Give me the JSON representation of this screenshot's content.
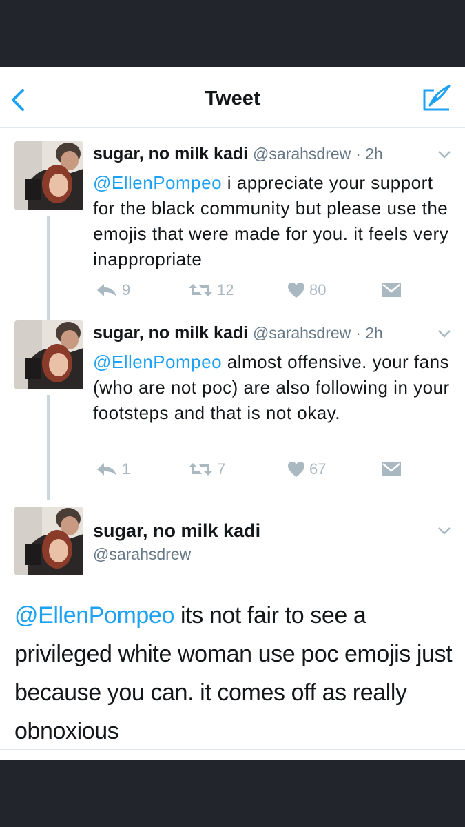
{
  "nav": {
    "title": "Tweet"
  },
  "tweets": [
    {
      "name": "sugar, no milk kadi",
      "handle": "@sarahsdrew",
      "time": "· 2h",
      "mention": "@EllenPompeo",
      "text": " i appreciate your support for the black community but please use the emojis that were made for you. it feels very inappropriate",
      "replies": "9",
      "retweets": "12",
      "likes": "80"
    },
    {
      "name": "sugar, no milk kadi",
      "handle": "@sarahsdrew",
      "time": "· 2h",
      "mention": "@EllenPompeo",
      "text": " almost offensive. your fans (who are not poc) are also following in your footsteps and that is not okay.",
      "replies": "1",
      "retweets": "7",
      "likes": "67"
    }
  ],
  "expanded_tweet": {
    "name": "sugar, no milk kadi",
    "handle": "@sarahsdrew",
    "mention": "@EllenPompeo",
    "text": " its not fair to see a privileged white woman use poc emojis just because you can. it comes off as really obnoxious"
  },
  "colors": {
    "accent": "#1da1f2",
    "frame": "#22252c",
    "muted_icon": "#aab8c2",
    "handle_grey": "#657786",
    "thread_line": "#ccd6dd"
  },
  "icons": [
    "back-chevron-icon",
    "compose-icon",
    "reply-icon",
    "retweet-icon",
    "heart-icon",
    "direct-message-icon",
    "chevron-down-icon"
  ]
}
